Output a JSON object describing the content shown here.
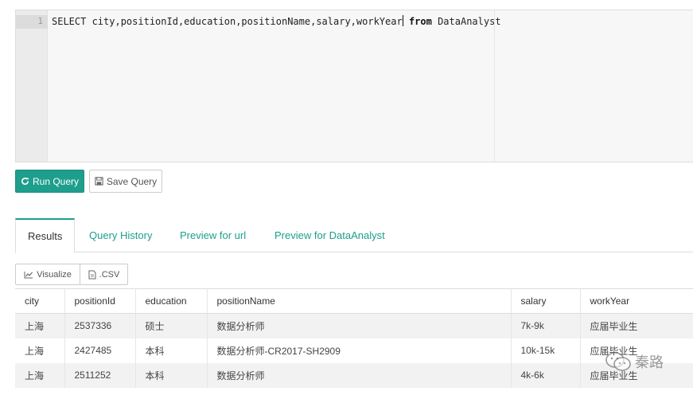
{
  "editor": {
    "line_number": "1",
    "sql_before_cursor": "SELECT city,positionId,education,positionName,salary,workYear",
    "sql_keyword": "from",
    "sql_after": " DataAnalyst"
  },
  "buttons": {
    "run_query": "Run Query",
    "save_query": "Save Query"
  },
  "tabs": [
    {
      "label": "Results",
      "active": true
    },
    {
      "label": "Query History",
      "active": false
    },
    {
      "label": "Preview for url",
      "active": false
    },
    {
      "label": "Preview for DataAnalyst",
      "active": false
    }
  ],
  "result_toolbar": {
    "visualize": "Visualize",
    "csv": ".CSV"
  },
  "table": {
    "columns": [
      "city",
      "positionId",
      "education",
      "positionName",
      "salary",
      "workYear"
    ],
    "rows": [
      [
        "上海",
        "2537336",
        "硕士",
        "数据分析师",
        "7k-9k",
        "应届毕业生"
      ],
      [
        "上海",
        "2427485",
        "本科",
        "数据分析师-CR2017-SH2909",
        "10k-15k",
        "应届毕业生"
      ],
      [
        "上海",
        "2511252",
        "本科",
        "数据分析师",
        "4k-6k",
        "应届毕业生"
      ]
    ]
  },
  "watermark": {
    "text": "秦路"
  },
  "colors": {
    "accent": "#1e9e8c"
  }
}
